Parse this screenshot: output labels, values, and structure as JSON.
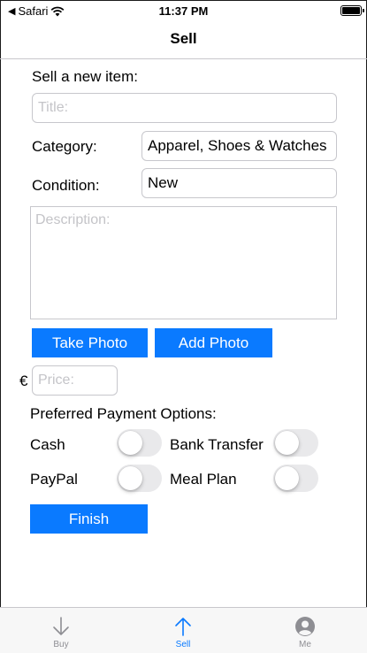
{
  "status_bar": {
    "back_app": "Safari",
    "time": "11:37 PM"
  },
  "nav": {
    "title": "Sell"
  },
  "form": {
    "heading": "Sell a new item:",
    "title_placeholder": "Title:",
    "category_label": "Category:",
    "category_value": "Apparel, Shoes & Watches",
    "condition_label": "Condition:",
    "condition_value": "New",
    "description_placeholder": "Description:",
    "take_photo_label": "Take Photo",
    "add_photo_label": "Add Photo",
    "currency_symbol": "€",
    "price_placeholder": "Price:",
    "payment_heading": "Preferred Payment Options:",
    "payment_options": [
      {
        "label": "Cash",
        "enabled": false
      },
      {
        "label": "Bank Transfer",
        "enabled": false
      },
      {
        "label": "PayPal",
        "enabled": false
      },
      {
        "label": "Meal Plan",
        "enabled": false
      }
    ],
    "finish_label": "Finish"
  },
  "tab_bar": {
    "tabs": [
      {
        "label": "Buy",
        "icon": "arrow-down-icon",
        "selected": false
      },
      {
        "label": "Sell",
        "icon": "arrow-up-icon",
        "selected": true
      },
      {
        "label": "Me",
        "icon": "person-icon",
        "selected": false
      }
    ]
  },
  "colors": {
    "accent": "#0a7aff",
    "inactive": "#8e8e93",
    "toggle_off": "#e9e9eb"
  }
}
